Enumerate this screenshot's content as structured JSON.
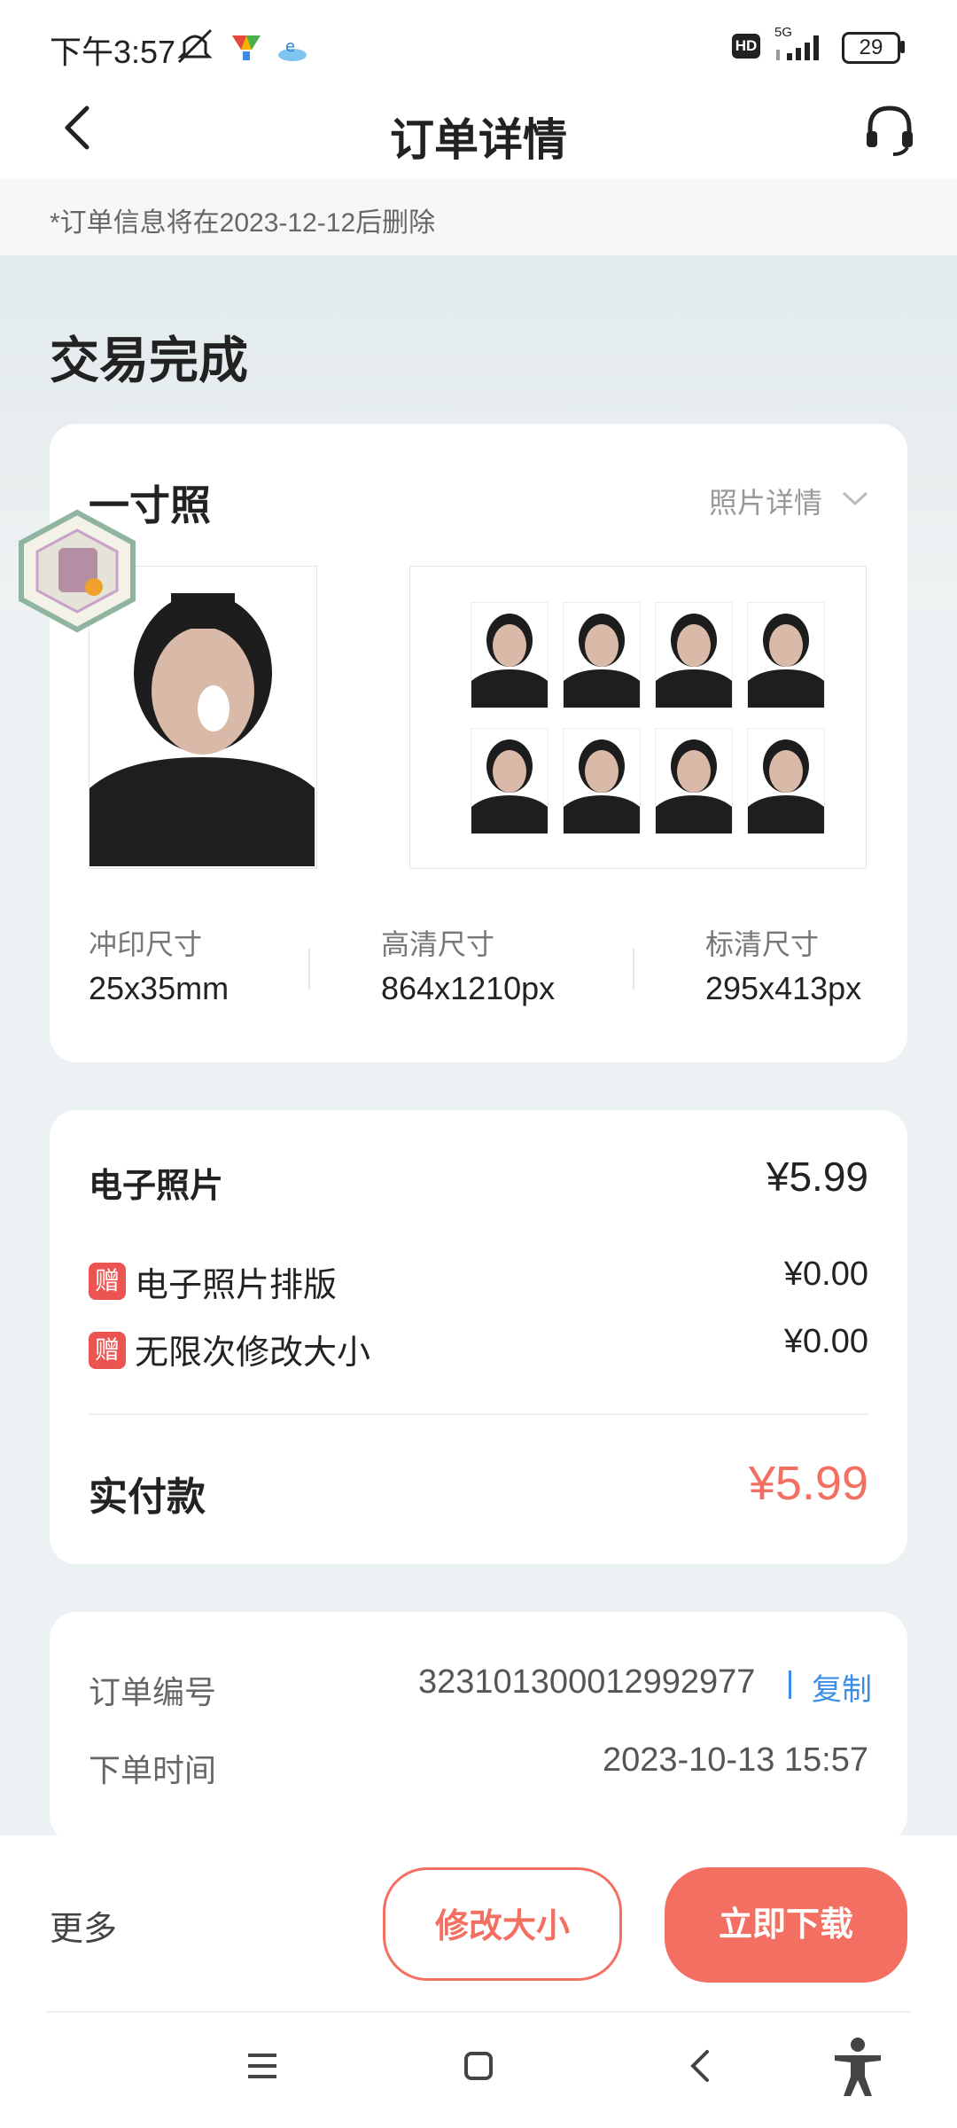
{
  "status_bar": {
    "time": "下午3:57",
    "network": "5G",
    "hd": "HD",
    "battery": "29"
  },
  "header": {
    "title": "订单详情"
  },
  "notice": "*订单信息将在2023-12-12后删除",
  "order_status": "交易完成",
  "photo_card": {
    "type_title": "一寸照",
    "detail_link": "照片详情",
    "specs": [
      {
        "label": "冲印尺寸",
        "value": "25x35mm"
      },
      {
        "label": "高清尺寸",
        "value": "864x1210px"
      },
      {
        "label": "标清尺寸",
        "value": "295x413px"
      }
    ]
  },
  "price_card": {
    "item_label": "电子照片",
    "item_price": "¥5.99",
    "gifts": [
      {
        "badge": "赠",
        "label": "电子照片排版",
        "price": "¥0.00"
      },
      {
        "badge": "赠",
        "label": "无限次修改大小",
        "price": "¥0.00"
      }
    ],
    "paid_label": "实付款",
    "paid_value": "¥5.99"
  },
  "order_info": {
    "number_label": "订单编号",
    "number_value": "323101300012992977",
    "copy_label": "复制",
    "time_label": "下单时间",
    "time_value": "2023-10-13 15:57"
  },
  "bottom_bar": {
    "more_label": "更多",
    "resize_button": "修改大小",
    "download_button": "立即下载"
  },
  "colors": {
    "accent": "#f36f61",
    "link": "#3a8ee6",
    "badge": "#ec5451"
  }
}
